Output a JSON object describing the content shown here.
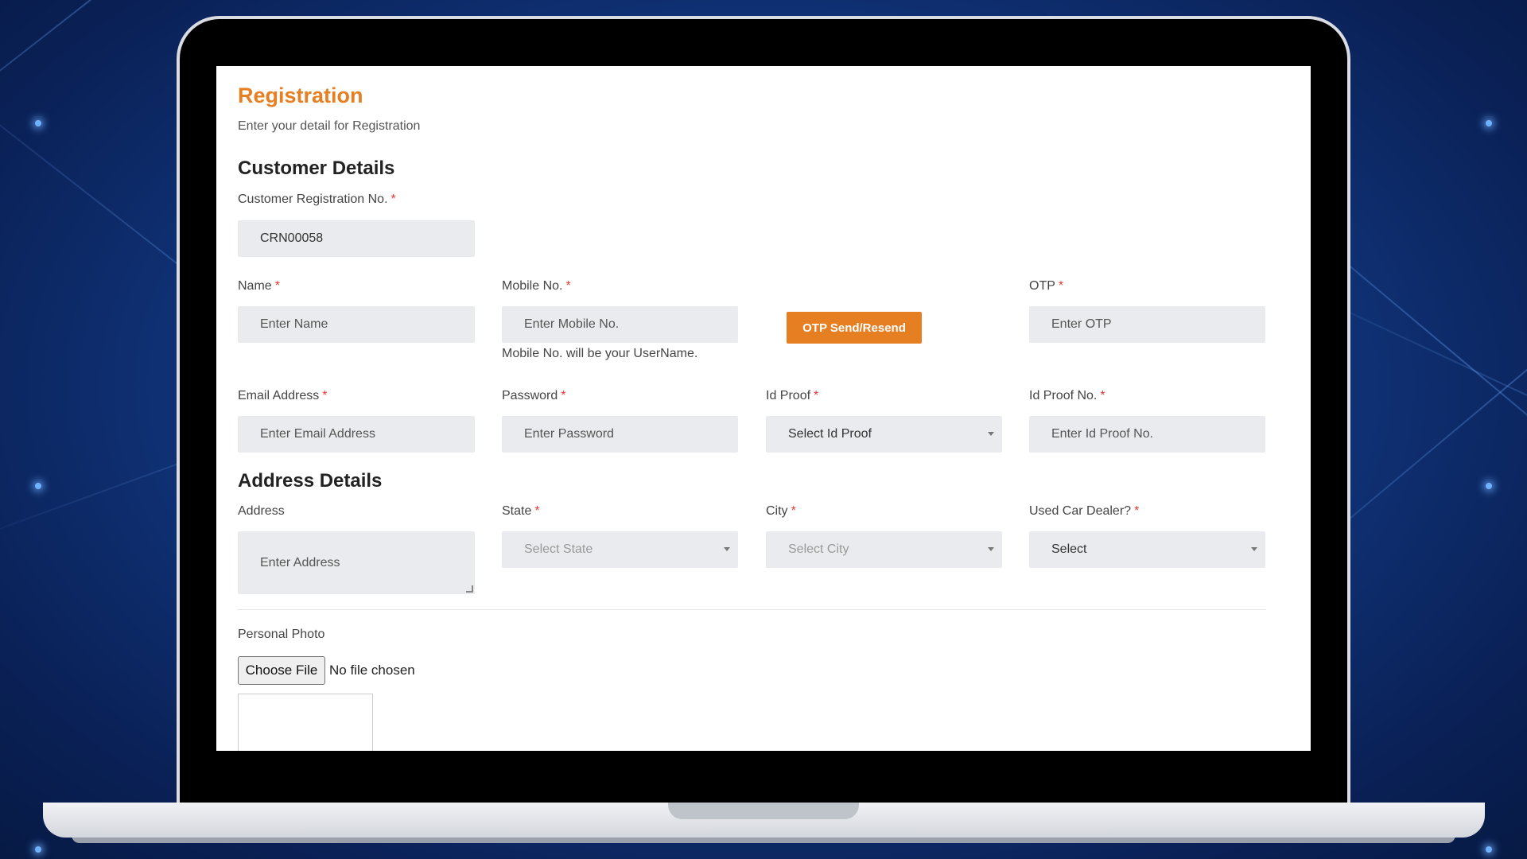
{
  "form": {
    "title": "Registration",
    "subtitle": "Enter your detail for Registration",
    "customer_section": "Customer Details",
    "crn": {
      "label": "Customer Registration No.",
      "value": "CRN00058"
    },
    "name": {
      "label": "Name",
      "placeholder": "Enter Name"
    },
    "mobile": {
      "label": "Mobile No.",
      "placeholder": "Enter  Mobile No.",
      "hint": "Mobile No. will be your UserName."
    },
    "otp_button": "OTP Send/Resend",
    "otp": {
      "label": "OTP",
      "placeholder": "Enter OTP"
    },
    "email": {
      "label": "Email Address",
      "placeholder": "Enter Email Address"
    },
    "password": {
      "label": "Password",
      "placeholder": "Enter Password"
    },
    "id_proof": {
      "label": "Id Proof",
      "selected": "Select Id Proof"
    },
    "id_proof_no": {
      "label": "Id Proof No.",
      "placeholder": "Enter Id Proof No."
    },
    "address_section": "Address Details",
    "address": {
      "label": "Address",
      "placeholder": "Enter Address"
    },
    "state": {
      "label": "State",
      "selected": "Select State"
    },
    "city": {
      "label": "City",
      "selected": "Select City"
    },
    "dealer": {
      "label": "Used Car Dealer?",
      "selected": "Select"
    },
    "photo": {
      "label": "Personal Photo",
      "button": "Choose File",
      "status": "No file chosen"
    },
    "required_mark": "*"
  },
  "colors": {
    "accent": "#e67e22",
    "required": "#e53935",
    "field_bg": "#e9ebee"
  }
}
